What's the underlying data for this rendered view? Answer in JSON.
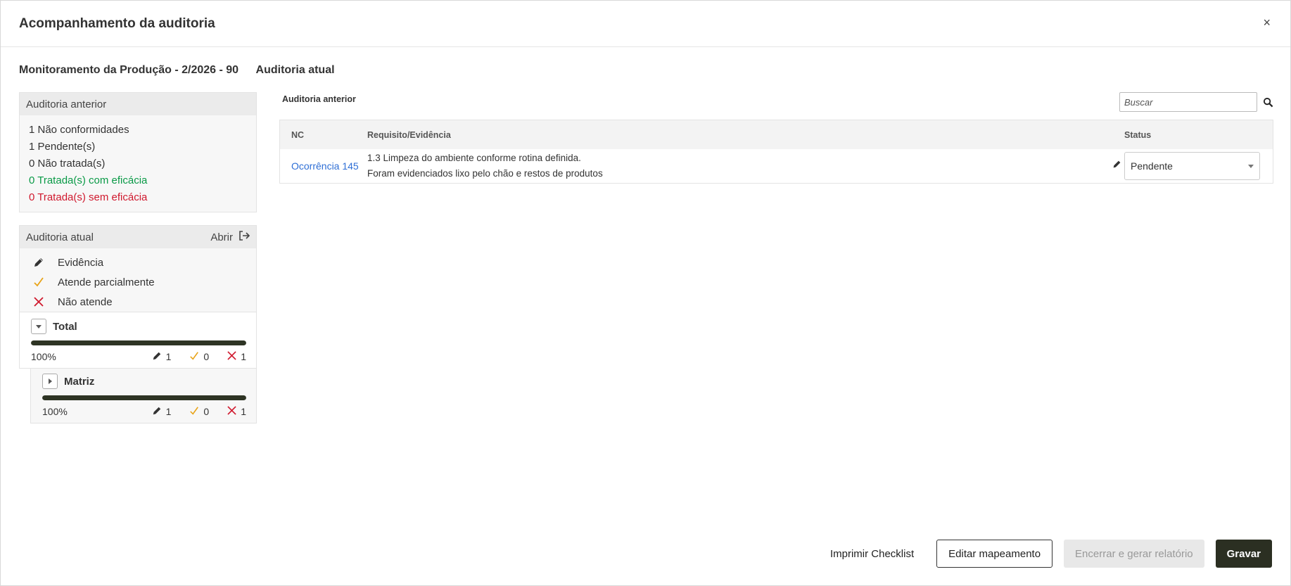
{
  "modal": {
    "title": "Acompanhamento da auditoria",
    "close_label": "×"
  },
  "subheader": {
    "name": "Monitoramento da Produção - 2/2026 - 90",
    "current": "Auditoria atual"
  },
  "previous_panel": {
    "title": "Auditoria anterior",
    "items": [
      {
        "text": "1 Não conformidades"
      },
      {
        "text": "1 Pendente(s)"
      },
      {
        "text": "0 Não tratada(s)"
      },
      {
        "text": "0 Tratada(s) com eficácia",
        "color": "#0a9a47"
      },
      {
        "text": "0 Tratada(s) sem eficácia",
        "color": "#d0192e"
      }
    ]
  },
  "current_panel": {
    "title": "Auditoria atual",
    "open_label": "Abrir",
    "legend": [
      {
        "icon": "pencil-icon",
        "label": "Evidência"
      },
      {
        "icon": "check-icon",
        "label": "Atende parcialmente"
      },
      {
        "icon": "x-icon",
        "label": "Não atende"
      }
    ],
    "total": {
      "label": "Total",
      "progress": 1.0,
      "percent_label": "100%",
      "evidence": "1",
      "partial": "0",
      "not_meet": "1"
    },
    "matriz": {
      "label": "Matriz",
      "progress": 1.0,
      "percent_label": "100%",
      "evidence": "1",
      "partial": "0",
      "not_meet": "1"
    }
  },
  "previous_table": {
    "title": "Auditoria anterior",
    "search_placeholder": "Buscar",
    "columns": {
      "nc": "NC",
      "req": "Requisito/Evidência",
      "status": "Status"
    },
    "rows": [
      {
        "nc": "Ocorrência 145",
        "requirement": "1.3 Limpeza do ambiente conforme rotina definida.",
        "evidence": "Foram evidenciados lixo pelo chão e restos de produtos",
        "status": "Pendente"
      }
    ]
  },
  "footer": {
    "print_label": "Imprimir Checklist",
    "edit_label": "Editar mapeamento",
    "close_label": "Encerrar e gerar relatório",
    "save_label": "Gravar"
  },
  "colors": {
    "accent": "#2b2f22",
    "link": "#2f6fd6",
    "success": "#0a9a47",
    "danger": "#d0192e",
    "partial": "#e8a317"
  }
}
